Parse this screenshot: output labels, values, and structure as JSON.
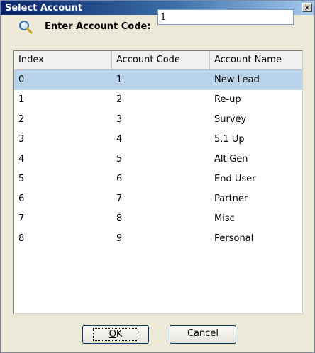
{
  "window": {
    "title": "Select Account",
    "close_glyph": "×"
  },
  "search": {
    "label": "Enter Account Code:",
    "value": "1",
    "icon": "search-icon"
  },
  "table": {
    "columns": [
      "Index",
      "Account Code",
      "Account Name"
    ],
    "selected_index": 0,
    "rows": [
      [
        "0",
        "1",
        "New Lead"
      ],
      [
        "1",
        "2",
        "Re-up"
      ],
      [
        "2",
        "3",
        "Survey"
      ],
      [
        "3",
        "4",
        "5.1 Up"
      ],
      [
        "4",
        "5",
        "AltiGen"
      ],
      [
        "5",
        "6",
        "End User"
      ],
      [
        "6",
        "7",
        "Partner"
      ],
      [
        "7",
        "8",
        "Misc"
      ],
      [
        "8",
        "9",
        "Personal"
      ]
    ]
  },
  "buttons": {
    "ok_first": "O",
    "ok_rest": "K",
    "cancel_first": "C",
    "cancel_rest": "ancel"
  },
  "colors": {
    "selected_row": "#b9d3ea",
    "title_bar": "#0a246a"
  }
}
